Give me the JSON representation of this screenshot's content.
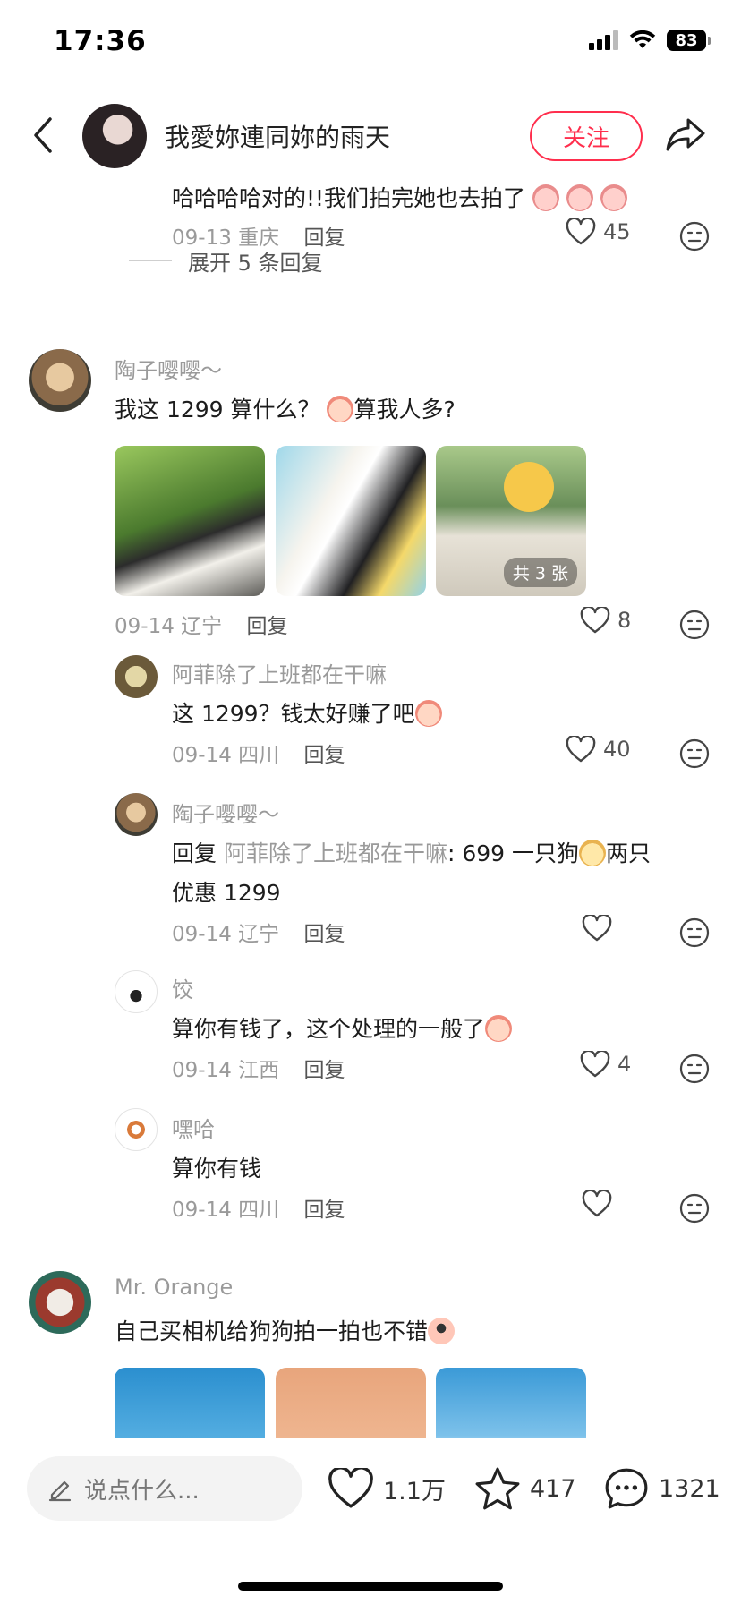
{
  "status_bar": {
    "time": "17:36",
    "battery": "83"
  },
  "header": {
    "username": "我愛妳連同妳的雨天",
    "follow_label": "关注"
  },
  "comments": {
    "prev_reply": {
      "text": "哈哈哈哈对的!!我们拍完她也去拍了",
      "date": "09-13",
      "region": "重庆",
      "reply_label": "回复",
      "likes": "45"
    },
    "expand_label": "展开 5 条回复",
    "c1": {
      "username": "陶子嘤嘤～",
      "text_before": "我这 1299 算什么？",
      "text_after": "算我人多?",
      "photo_count": "共 3 张",
      "date": "09-14",
      "region": "辽宁",
      "reply_label": "回复",
      "likes": "8",
      "replies": [
        {
          "username": "阿菲除了上班都在干嘛",
          "text": "这 1299？钱太好赚了吧",
          "date": "09-14",
          "region": "四川",
          "reply_label": "回复",
          "likes": "40"
        },
        {
          "username": "陶子嘤嘤～",
          "reply_prefix": "回复",
          "reply_to": "阿菲除了上班都在干嘛",
          "text_line1": ": 699 一只狗",
          "text_line1b": "两只",
          "text_line2": "优惠 1299",
          "date": "09-14",
          "region": "辽宁",
          "reply_label": "回复",
          "likes": ""
        },
        {
          "username": "饺",
          "text": "算你有钱了，这个处理的一般了",
          "date": "09-14",
          "region": "江西",
          "reply_label": "回复",
          "likes": "4"
        },
        {
          "username": "嘿哈",
          "text": "算你有钱",
          "date": "09-14",
          "region": "四川",
          "reply_label": "回复",
          "likes": ""
        }
      ]
    },
    "c2": {
      "username": "Mr. Orange",
      "text": "自己买相机给狗狗拍一拍也不错"
    }
  },
  "bottom_bar": {
    "input_placeholder": "说点什么...",
    "likes": "1.1万",
    "favorites": "417",
    "comments": "1321"
  },
  "colors": {
    "accent": "#ff2e4d",
    "meta_gray": "#9a9a9a"
  },
  "icons": [
    "back-icon",
    "share-icon",
    "heart-icon",
    "emoji-face-icon",
    "pencil-icon",
    "star-icon",
    "comment-bubble-icon"
  ]
}
